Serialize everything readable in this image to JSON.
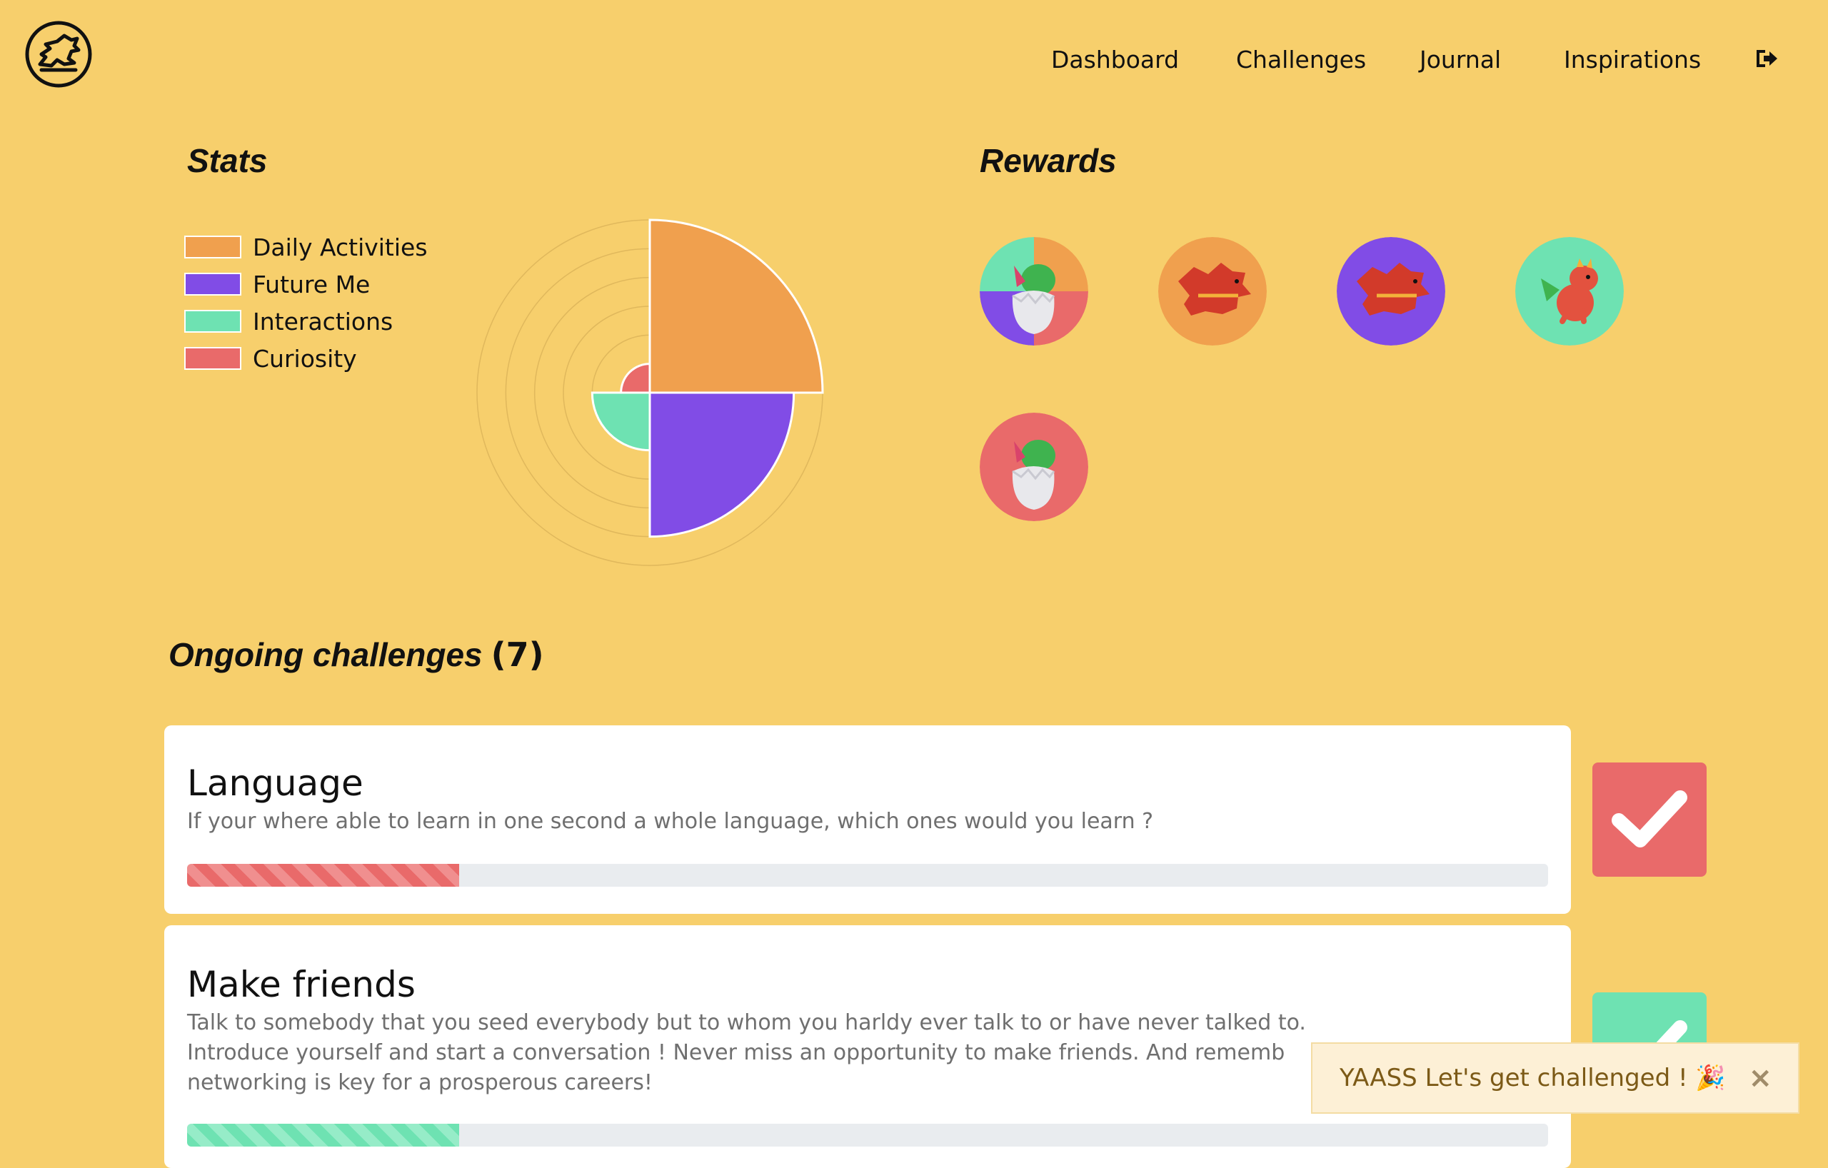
{
  "nav": {
    "items": [
      "Dashboard",
      "Challenges",
      "Journal",
      "Inspirations"
    ],
    "logout_icon": "sign-out-icon",
    "logo_icon": "dragon-logo-icon"
  },
  "stats": {
    "title": "Stats",
    "legend": [
      {
        "label": "Daily Activities",
        "color": "#f0a04e"
      },
      {
        "label": "Future Me",
        "color": "#814ce6"
      },
      {
        "label": "Interactions",
        "color": "#6ee2b2"
      },
      {
        "label": "Curiosity",
        "color": "#e96a6a"
      }
    ]
  },
  "chart_data": {
    "type": "polar-area",
    "categories": [
      "Daily Activities",
      "Future Me",
      "Interactions",
      "Curiosity"
    ],
    "values": [
      6,
      5,
      2,
      1
    ],
    "rmax": 6,
    "rings": 6,
    "colors": [
      "#f0a04e",
      "#814ce6",
      "#6ee2b2",
      "#e96a6a"
    ],
    "grid": true,
    "legend": "left"
  },
  "rewards": {
    "title": "Rewards",
    "badges": [
      {
        "name": "dragon-egg-multicolor-badge"
      },
      {
        "name": "red-dragon-orange-badge"
      },
      {
        "name": "red-dragon-purple-badge"
      },
      {
        "name": "baby-dragon-green-badge"
      },
      {
        "name": "dragon-egg-red-badge"
      }
    ]
  },
  "ongoing": {
    "title": "Ongoing challenges",
    "count": "(7)",
    "challenges": [
      {
        "title": "Language",
        "desc": "If your where able to learn in one second a whole language, which ones would you learn ?",
        "progress": 0.2,
        "color": "#e96a6a"
      },
      {
        "title": "Make friends",
        "desc": "Talk to somebody that you seed everybody but to whom you harldy ever talk to or have never talked to.\nIntroduce yourself and start a conversation ! Never miss an opportunity to make friends. And rememb...\nnetworking is key for a prosperous careers!",
        "desc_lines": [
          "Talk to somebody that you seed everybody but to whom you harldy ever talk to or have never talked to.",
          "Introduce yourself and start a conversation ! Never miss an opportunity to make friends. And rememb",
          "networking is key for a prosperous careers!"
        ],
        "progress": 0.2,
        "color": "#6ee2b2"
      }
    ]
  },
  "toast": {
    "message": "YAASS Let's get challenged ! 🎉",
    "close": "×"
  }
}
